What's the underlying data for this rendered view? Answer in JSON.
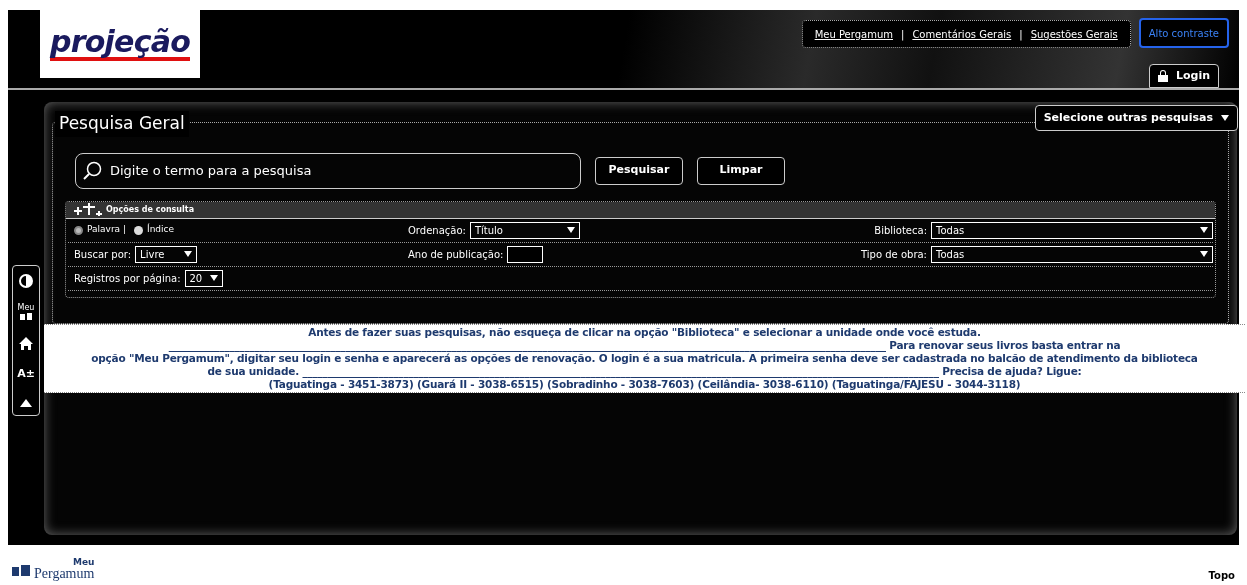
{
  "header": {
    "logo": "projeção",
    "links": [
      "Meu Pergamum",
      "Comentários Gerais",
      "Sugestões Gerais"
    ],
    "separator": "|",
    "contrast_button": "Alto contraste",
    "login_button": "Login"
  },
  "search": {
    "title": "Pesquisa Geral",
    "other_searches": "Selecione outras pesquisas",
    "placeholder": "Digite o termo para a pesquisa",
    "buttons": [
      "Pesquisar",
      "Limpar"
    ]
  },
  "options": {
    "title": "Opções de consulta",
    "expanded": true,
    "modes": [
      {
        "label": "Palavra |",
        "selected": true
      },
      {
        "label": "Índice",
        "selected": false
      }
    ],
    "ordering": {
      "label": "Ordenação:",
      "value": "Título"
    },
    "library": {
      "label": "Biblioteca:",
      "value": "Todas"
    },
    "search_by": {
      "label": "Buscar por:",
      "value": "Livre"
    },
    "year": {
      "label": "Ano de publicação:"
    },
    "work_type": {
      "label": "Tipo de obra:",
      "value": "Todas"
    },
    "per_page": {
      "label": "Registros por página:",
      "value": "20"
    }
  },
  "notice": [
    "Antes de fazer suas pesquisas, não esqueça de clicar na opção \"Biblioteca\" e selecionar a unidade onde você estuda.",
    "______________________________________________________________________________________________________________________________________________ Para renovar seus livros basta entrar na",
    "opção \"Meu Pergamum\", digitar seu login e senha e aparecerá as opções de renovação. O login é a sua matricula. A primeira senha deve ser cadastrada no balcão de atendimento da biblioteca",
    "de sua unidade. ______________________________________________________________________________________________________________________________ Precisa de ajuda? Ligue:",
    "(Taguatinga - 3451-3873) (Guará II - 3038-6515) (Sobradinho - 3038-7603) (Ceilândia- 3038-6110) (Taguatinga/FAJESU - 3044-3118)"
  ],
  "side_tools": [
    {
      "kind": "contrast"
    },
    {
      "kind": "meu",
      "label": "Meu"
    },
    {
      "kind": "home"
    },
    {
      "kind": "font",
      "label": "A±"
    },
    {
      "kind": "up"
    }
  ],
  "footer": {
    "logo_small": "Meu",
    "logo": "Pergamum",
    "top_link": "Topo"
  }
}
